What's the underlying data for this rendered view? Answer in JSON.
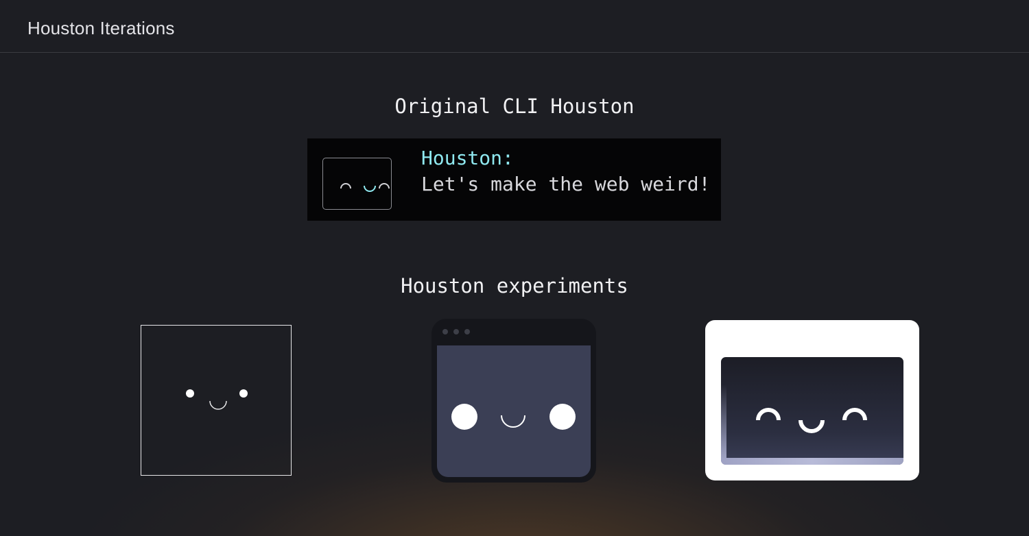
{
  "header": {
    "title": "Houston Iterations"
  },
  "sections": {
    "original": {
      "title": "Original CLI Houston",
      "cli": {
        "speaker": "Houston:",
        "message": "Let's make the web weird!"
      }
    },
    "experiments": {
      "title": "Houston experiments",
      "items": [
        {
          "name": "outline-face"
        },
        {
          "name": "window-face"
        },
        {
          "name": "card-face"
        }
      ]
    }
  },
  "colors": {
    "background": "#1d1e23",
    "cli_accent": "#8fe8ef",
    "cli_text": "#d8d8dc",
    "window_screen": "#3b3f55",
    "card_background": "#ffffff"
  }
}
